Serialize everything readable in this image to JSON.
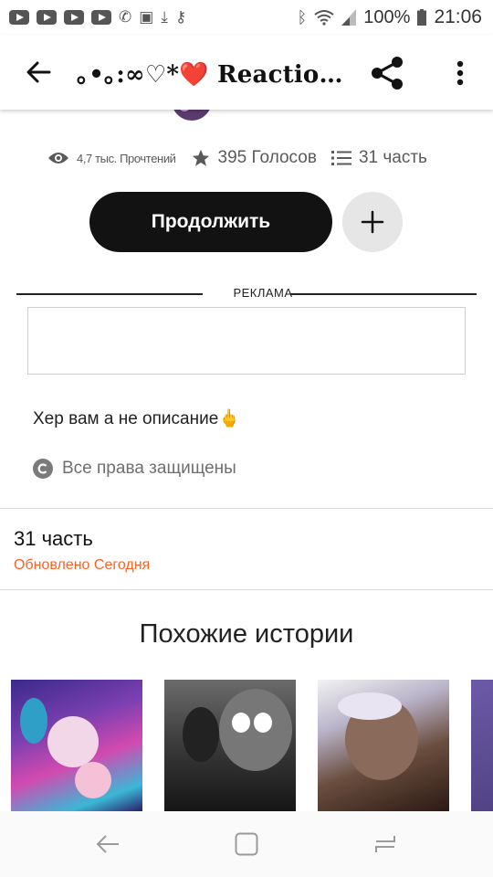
{
  "status_bar": {
    "battery": "100%",
    "time": "21:06"
  },
  "app_bar": {
    "title": "｡•｡:∞♡*❤️ Reactio…"
  },
  "stats": {
    "reads": "4,7 тыс. Прочтений",
    "votes": "395 Голосов",
    "parts": "31 часть"
  },
  "actions": {
    "continue_label": "Продолжить"
  },
  "ad": {
    "label": "РЕКЛАМА"
  },
  "story": {
    "description": "Хер вам а не описание🖕",
    "copyright": "Все права защищены"
  },
  "table_of_contents": {
    "parts_count": "31 часть",
    "updated": "Обновлено Сегодня"
  },
  "similar": {
    "heading": "Похожие истории"
  },
  "colors": {
    "accent_orange": "#ff6122",
    "button_dark": "#121212",
    "add_button_bg": "#e6e6e6"
  }
}
